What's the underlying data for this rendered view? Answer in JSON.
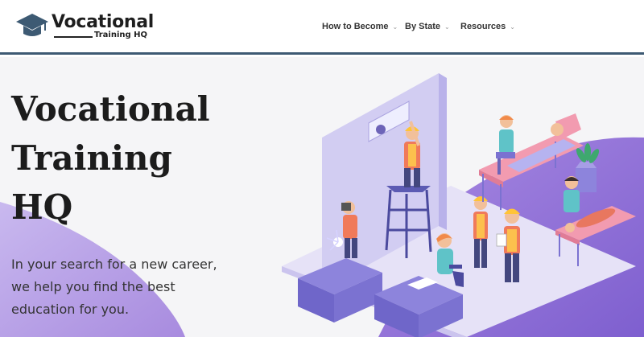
{
  "header": {
    "logo": {
      "main": "Vocational",
      "sub": "Training HQ",
      "icon": "graduation-cap-icon"
    },
    "nav": [
      {
        "label": "How to Become",
        "icon": "chevron-down-icon"
      },
      {
        "label": "By State",
        "icon": "chevron-down-icon"
      },
      {
        "label": "Resources",
        "icon": "chevron-down-icon"
      }
    ]
  },
  "hero": {
    "title_lines": [
      "Vocational",
      "Training",
      "HQ"
    ],
    "subtitle_lines": [
      "In your search for a new career,",
      "we help you find the best",
      "education for you."
    ]
  },
  "colors": {
    "header_border": "#3d5a73",
    "logo_cap": "#3d5a73",
    "purple_accent": "#8f6fd6",
    "purple_light": "#c9b8f0"
  }
}
